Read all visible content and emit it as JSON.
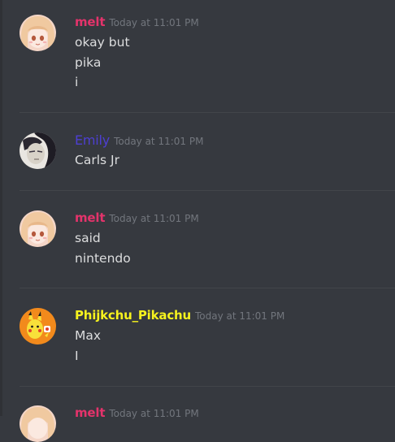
{
  "colors": {
    "background": "#36393f",
    "melt": "#e4336b",
    "emily": "#4d3fd1",
    "phijkchu": "#f6f21e",
    "text": "#dcddde",
    "timestamp": "#72767d"
  },
  "messages": [
    {
      "username": "melt",
      "timestamp": "Today at 11:01 PM",
      "avatar": "anime-girl-avatar",
      "lines": [
        "okay but",
        "pika",
        "i"
      ]
    },
    {
      "username": "Emily",
      "timestamp": "Today at 11:01 PM",
      "avatar": "dark-hair-avatar",
      "lines": [
        "Carls Jr"
      ]
    },
    {
      "username": "melt",
      "timestamp": "Today at 11:01 PM",
      "avatar": "anime-girl-avatar",
      "lines": [
        "said",
        "nintendo"
      ]
    },
    {
      "username": "Phijkchu_Pikachu",
      "timestamp": "Today at 11:01 PM",
      "avatar": "pikachu-avatar",
      "lines": [
        "Max",
        "I"
      ]
    },
    {
      "username": "melt",
      "timestamp": "Today at 11:01 PM",
      "avatar": "anime-girl-avatar",
      "lines": []
    }
  ]
}
